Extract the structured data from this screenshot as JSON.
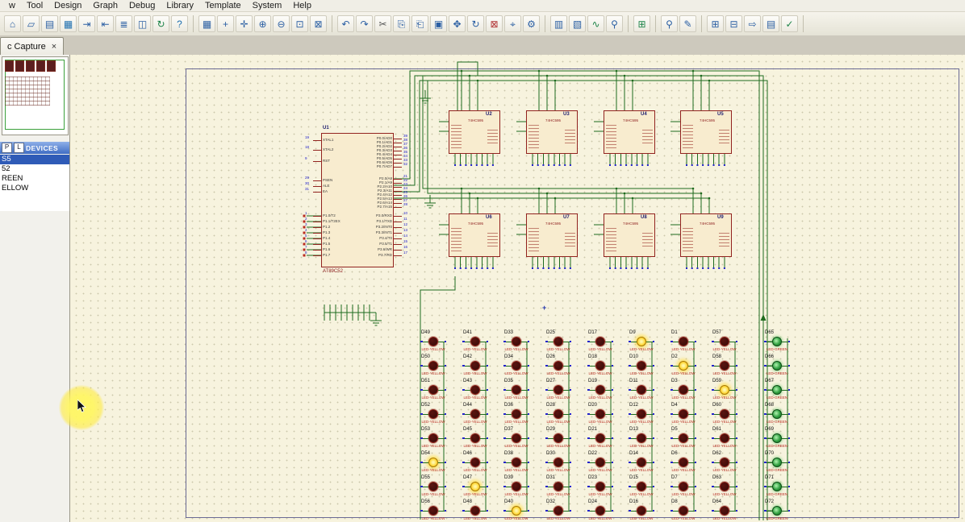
{
  "window": {
    "tab_label": "c Capture",
    "tab_close": "×"
  },
  "menu": {
    "items": [
      "w",
      "Tool",
      "Design",
      "Graph",
      "Debug",
      "Library",
      "Template",
      "System",
      "Help"
    ]
  },
  "toolbar": {
    "groups": [
      [
        {
          "name": "home-icon",
          "glyph": "⌂"
        },
        {
          "name": "new-design-icon",
          "glyph": "▱"
        },
        {
          "name": "open-design-icon",
          "glyph": "▤"
        },
        {
          "name": "save-design-icon",
          "glyph": "▦",
          "color": "#1E6FAF"
        },
        {
          "name": "import-section-icon",
          "glyph": "⇥"
        },
        {
          "name": "export-section-icon",
          "glyph": "⇤"
        },
        {
          "name": "print-icon",
          "glyph": "≣"
        },
        {
          "name": "mark-output-area-icon",
          "glyph": "◫"
        },
        {
          "name": "refresh-icon",
          "glyph": "↻",
          "color": "#1E8449"
        },
        {
          "name": "help-icon",
          "glyph": "?",
          "color": "#1E6FAF"
        }
      ],
      [
        {
          "name": "grid-toggle-icon",
          "glyph": "▦"
        },
        {
          "name": "false-origin-icon",
          "glyph": "+"
        },
        {
          "name": "center-at-cursor-icon",
          "glyph": "✛"
        },
        {
          "name": "zoom-in-icon",
          "glyph": "⊕"
        },
        {
          "name": "zoom-out-icon",
          "glyph": "⊖"
        },
        {
          "name": "zoom-area-icon",
          "glyph": "⊡"
        },
        {
          "name": "zoom-all-icon",
          "glyph": "⊠"
        }
      ],
      [
        {
          "name": "undo-icon",
          "glyph": "↶"
        },
        {
          "name": "redo-icon",
          "glyph": "↷"
        },
        {
          "name": "cut-icon",
          "glyph": "✂",
          "color": "#555"
        },
        {
          "name": "copy-icon",
          "glyph": "⎘"
        },
        {
          "name": "paste-icon",
          "glyph": "⎗"
        },
        {
          "name": "block-copy-icon",
          "glyph": "▣"
        },
        {
          "name": "block-move-icon",
          "glyph": "✥"
        },
        {
          "name": "block-rotate-icon",
          "glyph": "↻"
        },
        {
          "name": "block-delete-icon",
          "glyph": "⊠",
          "color": "#B03030"
        },
        {
          "name": "pick-parts-icon",
          "glyph": "⌖"
        },
        {
          "name": "make-device-icon",
          "glyph": "⚙"
        }
      ],
      [
        {
          "name": "packaging-tool-icon",
          "glyph": "▥"
        },
        {
          "name": "decompose-icon",
          "glyph": "▧"
        },
        {
          "name": "wire-autorouter-icon",
          "glyph": "∿",
          "color": "#1E8449"
        },
        {
          "name": "search-tag-icon",
          "glyph": "⚲"
        }
      ],
      [
        {
          "name": "design-explorer-icon",
          "glyph": "⊞",
          "color": "#1E8449"
        }
      ],
      [
        {
          "name": "find-component-icon",
          "glyph": "⚲"
        },
        {
          "name": "property-assignment-icon",
          "glyph": "✎"
        }
      ],
      [
        {
          "name": "new-root-sheet-icon",
          "glyph": "⊞"
        },
        {
          "name": "remove-sheet-icon",
          "glyph": "⊟"
        },
        {
          "name": "exit-to-parent-icon",
          "glyph": "⇨"
        },
        {
          "name": "bill-of-materials-icon",
          "glyph": "▤"
        },
        {
          "name": "electrical-rule-check-icon",
          "glyph": "✓",
          "color": "#1E8449"
        }
      ]
    ]
  },
  "sidebar": {
    "devices_title": "DEVICES",
    "pick_button": "P",
    "library_button": "L",
    "items": [
      {
        "label": "S5",
        "selected": true
      },
      {
        "label": "52",
        "selected": false
      },
      {
        "label": "REEN",
        "selected": false
      },
      {
        "label": "ELLOW",
        "selected": false
      }
    ]
  },
  "schematic": {
    "origin_marker": "+",
    "mcu": {
      "ref": "U1",
      "part": "AT89C52",
      "left_pins": [
        {
          "num": "19",
          "name": "XTAL1"
        },
        {
          "num": "18",
          "name": "XTAL2"
        },
        {
          "num": "9",
          "name": "RST"
        },
        {
          "num": "29",
          "name": "PSEN"
        },
        {
          "num": "30",
          "name": "ALE"
        },
        {
          "num": "31",
          "name": "EA"
        },
        {
          "num": "1",
          "name": "P1.0/T2"
        },
        {
          "num": "2",
          "name": "P1.1/T2EX"
        },
        {
          "num": "3",
          "name": "P1.2"
        },
        {
          "num": "4",
          "name": "P1.3"
        },
        {
          "num": "5",
          "name": "P1.4"
        },
        {
          "num": "6",
          "name": "P1.5"
        },
        {
          "num": "7",
          "name": "P1.6"
        },
        {
          "num": "8",
          "name": "P1.7"
        }
      ],
      "right_pins": [
        {
          "num": "39",
          "name": "P0.0/AD0"
        },
        {
          "num": "38",
          "name": "P0.1/AD1"
        },
        {
          "num": "37",
          "name": "P0.2/AD2"
        },
        {
          "num": "36",
          "name": "P0.3/AD3"
        },
        {
          "num": "35",
          "name": "P0.4/AD4"
        },
        {
          "num": "34",
          "name": "P0.5/AD5"
        },
        {
          "num": "33",
          "name": "P0.6/AD6"
        },
        {
          "num": "32",
          "name": "P0.7/AD7"
        },
        {
          "num": "21",
          "name": "P2.0/A8"
        },
        {
          "num": "22",
          "name": "P2.1/A9"
        },
        {
          "num": "23",
          "name": "P2.2/A10"
        },
        {
          "num": "24",
          "name": "P2.3/A11"
        },
        {
          "num": "25",
          "name": "P2.4/A12"
        },
        {
          "num": "26",
          "name": "P2.5/A13"
        },
        {
          "num": "27",
          "name": "P2.6/A14"
        },
        {
          "num": "28",
          "name": "P2.7/A15"
        },
        {
          "num": "10",
          "name": "P3.0/RXD"
        },
        {
          "num": "11",
          "name": "P3.1/TXD"
        },
        {
          "num": "12",
          "name": "P3.2/INT0"
        },
        {
          "num": "13",
          "name": "P3.3/INT1"
        },
        {
          "num": "14",
          "name": "P3.4/T0"
        },
        {
          "num": "15",
          "name": "P3.5/T1"
        },
        {
          "num": "16",
          "name": "P3.6/WR"
        },
        {
          "num": "17",
          "name": "P3.7/RD"
        }
      ]
    },
    "shift_registers": {
      "part": "74HC595",
      "refs": [
        "U2",
        "U3",
        "U4",
        "U5",
        "U6",
        "U7",
        "U8",
        "U9"
      ]
    },
    "led_matrix": {
      "prefix": "D",
      "rows": 8,
      "yellow_type": "LED-YELLOW",
      "green_type": "LED-GREEN",
      "columns": [
        {
          "start": 49
        },
        {
          "start": 41
        },
        {
          "start": 33
        },
        {
          "start": 25
        },
        {
          "start": 17
        },
        {
          "start": 9
        },
        {
          "start": 1
        },
        {
          "start": 57
        }
      ],
      "green_column": {
        "start": 65,
        "count": 8
      },
      "lit_yellow": [
        "D9",
        "D2",
        "D59",
        "D54",
        "D47",
        "D40"
      ]
    }
  },
  "colors": {
    "wire": "#1E6B1E",
    "component_outline": "#92231F",
    "canvas": "#F7F3DE",
    "selection": "#2F5BB7",
    "led_yellow_lit": "#FFD93B",
    "led_green": "#2F9E3F",
    "led_off": "#3A0C08",
    "pin_number_blue": "#2222CC"
  }
}
